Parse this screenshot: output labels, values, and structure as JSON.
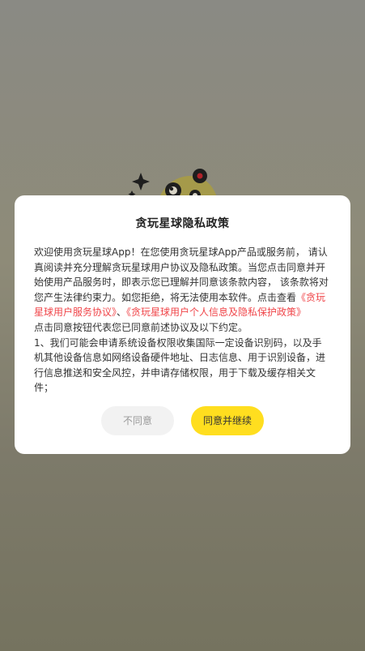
{
  "colors": {
    "accent_yellow": "#ffde1f",
    "link_red": "#f0464a",
    "disagree_bg": "#f2f2f2",
    "overlay": "#8a8a84"
  },
  "background": {
    "mascot_icon": "planet-mascot-icon"
  },
  "dialog": {
    "title": "贪玩星球隐私政策",
    "body_intro": "欢迎使用贪玩星球App！在您使用贪玩星球App产品或服务前， 请认真阅读并充分理解贪玩星球用户协议及隐私政策。当您点击同意并开始使用产品服务时，即表示您已理解并同意该条款内容， 该条款将对您产生法律约束力。如您拒绝，将无法使用本软件。点击查看",
    "link_user_agreement": "《贪玩星球用户服务协议》",
    "separator": "、",
    "link_privacy_policy": "《贪玩星球用户个人信息及隐私保护政策》",
    "body_after_links": "点击同意按钮代表您已同意前述协议及以下约定。",
    "body_clause_1": "1、我们可能会申请系统设备权限收集国际一定设备识别码，以及手机其他设备信息如网络设备硬件地址、日志信息、用于识别设备，进行信息推送和安全风控，并申请存储权限，用于下载及缓存相关文件；",
    "disagree_label": "不同意",
    "agree_label": "同意并继续"
  }
}
